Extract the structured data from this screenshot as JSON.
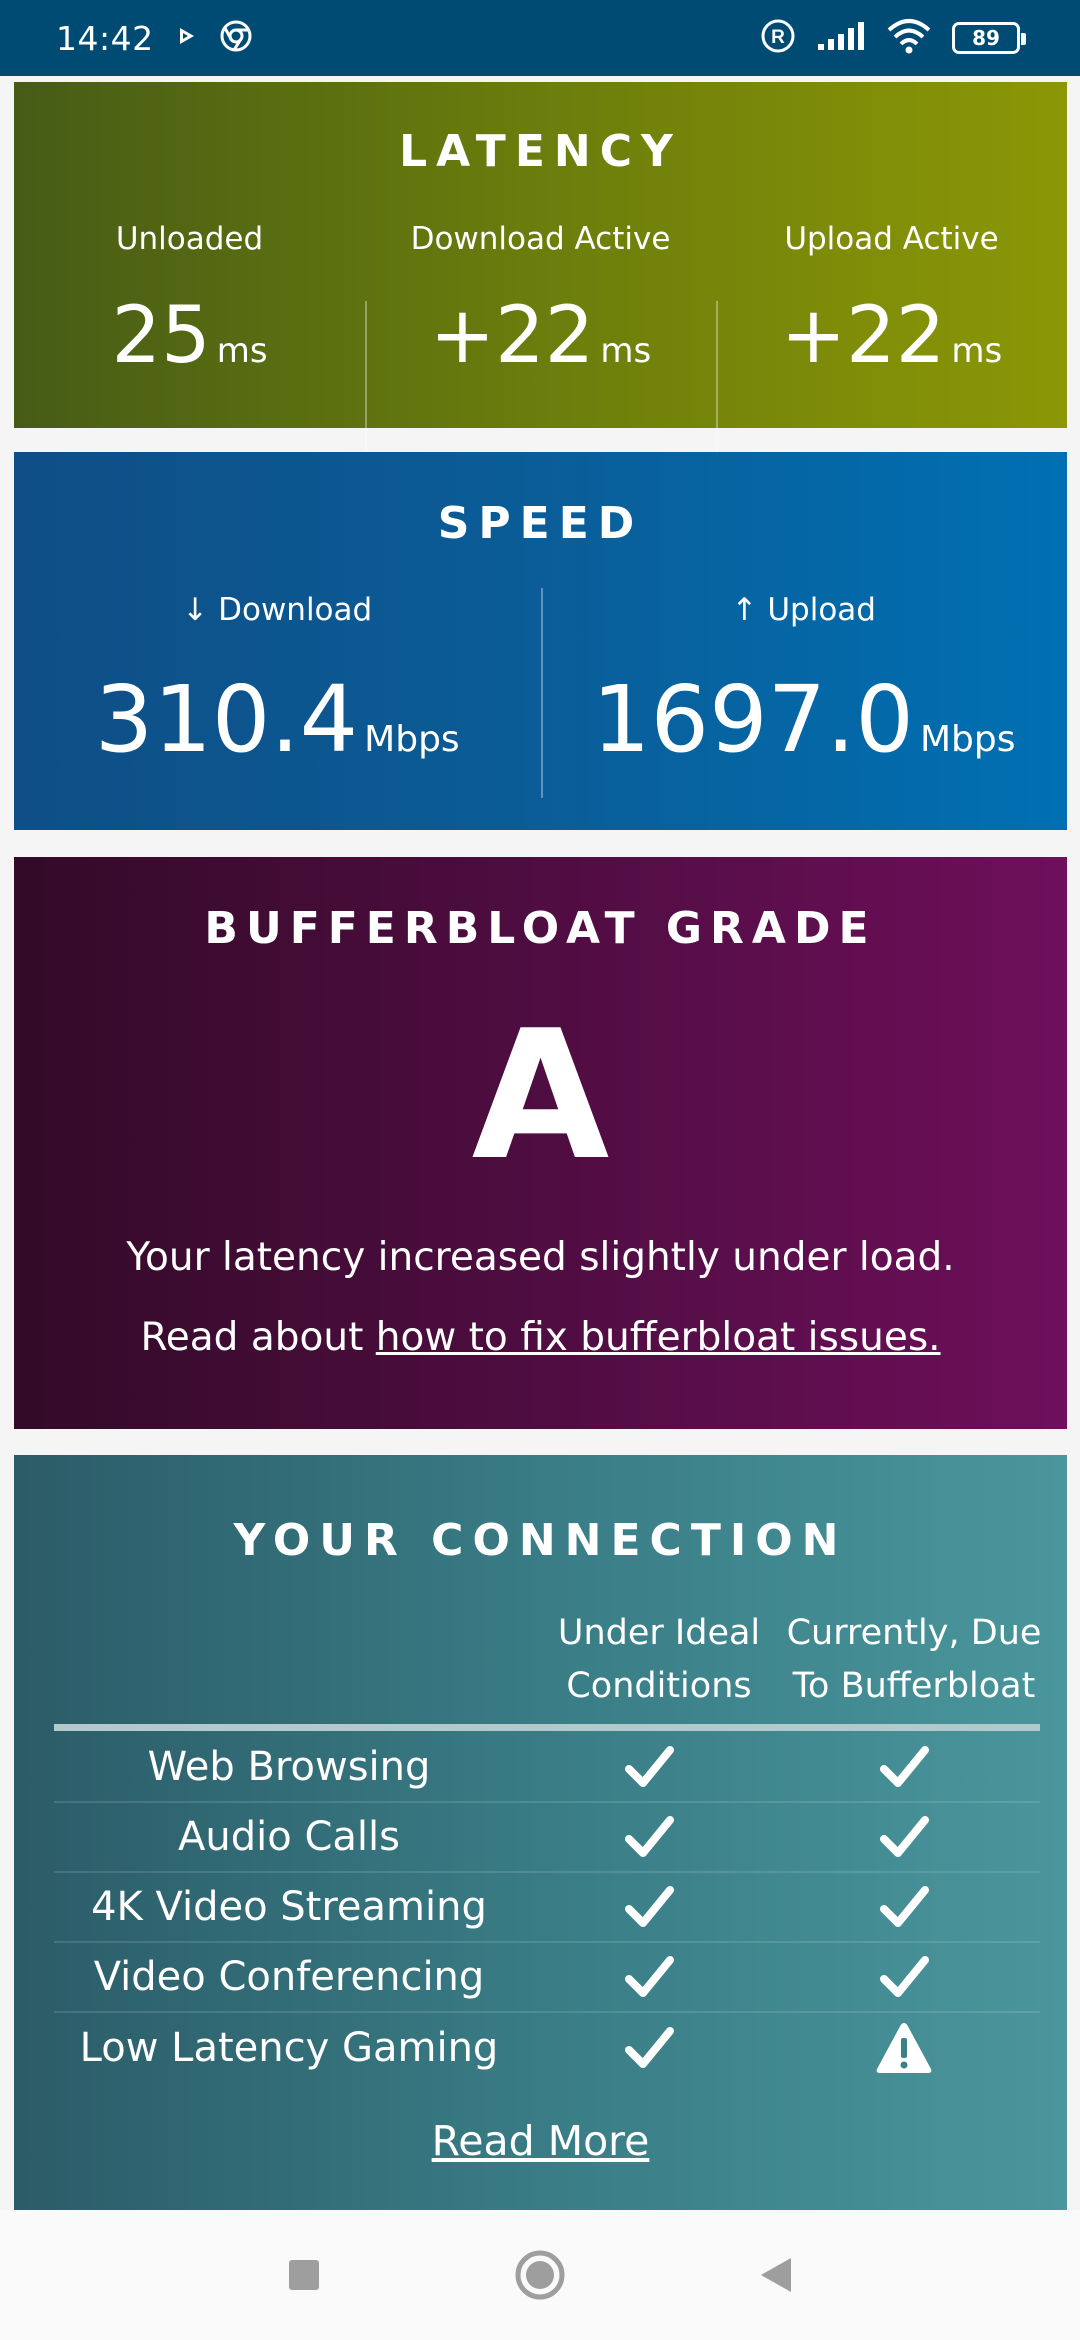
{
  "status_bar": {
    "time": "14:42",
    "battery": "89",
    "icons": [
      "play-icon",
      "chrome-icon",
      "registered-icon",
      "signal-icon",
      "wifi-icon",
      "battery-icon"
    ]
  },
  "latency": {
    "title": "LATENCY",
    "columns": [
      {
        "label": "Unloaded",
        "value": "25",
        "unit": "ms"
      },
      {
        "label": "Download Active",
        "value": "+22",
        "unit": "ms"
      },
      {
        "label": "Upload Active",
        "value": "+22",
        "unit": "ms"
      }
    ]
  },
  "speed": {
    "title": "SPEED",
    "download": {
      "label": "↓ Download",
      "value": "310.4",
      "unit": "Mbps"
    },
    "upload": {
      "label": "↑ Upload",
      "value": "1697.0",
      "unit": "Mbps"
    }
  },
  "grade": {
    "title": "BUFFERBLOAT GRADE",
    "letter": "A",
    "message": "Your latency increased slightly under load.",
    "read_prefix": "Read about ",
    "link_text": "how to fix bufferbloat issues."
  },
  "connection": {
    "title": "YOUR CONNECTION",
    "col_ideal": "Under Ideal Conditions",
    "col_current": "Currently, Due To Bufferbloat",
    "rows": [
      {
        "name": "Web Browsing",
        "ideal": "check",
        "current": "check"
      },
      {
        "name": "Audio Calls",
        "ideal": "check",
        "current": "check"
      },
      {
        "name": "4K Video Streaming",
        "ideal": "check",
        "current": "check"
      },
      {
        "name": "Video Conferencing",
        "ideal": "check",
        "current": "check"
      },
      {
        "name": "Low Latency Gaming",
        "ideal": "check",
        "current": "warning"
      }
    ],
    "read_more": "Read More"
  },
  "colors": {
    "status_bar": "#004b73",
    "latency": "#6b7d0c",
    "speed": "#0a5d98",
    "grade": "#4f0d41",
    "connection": "#397c85"
  }
}
